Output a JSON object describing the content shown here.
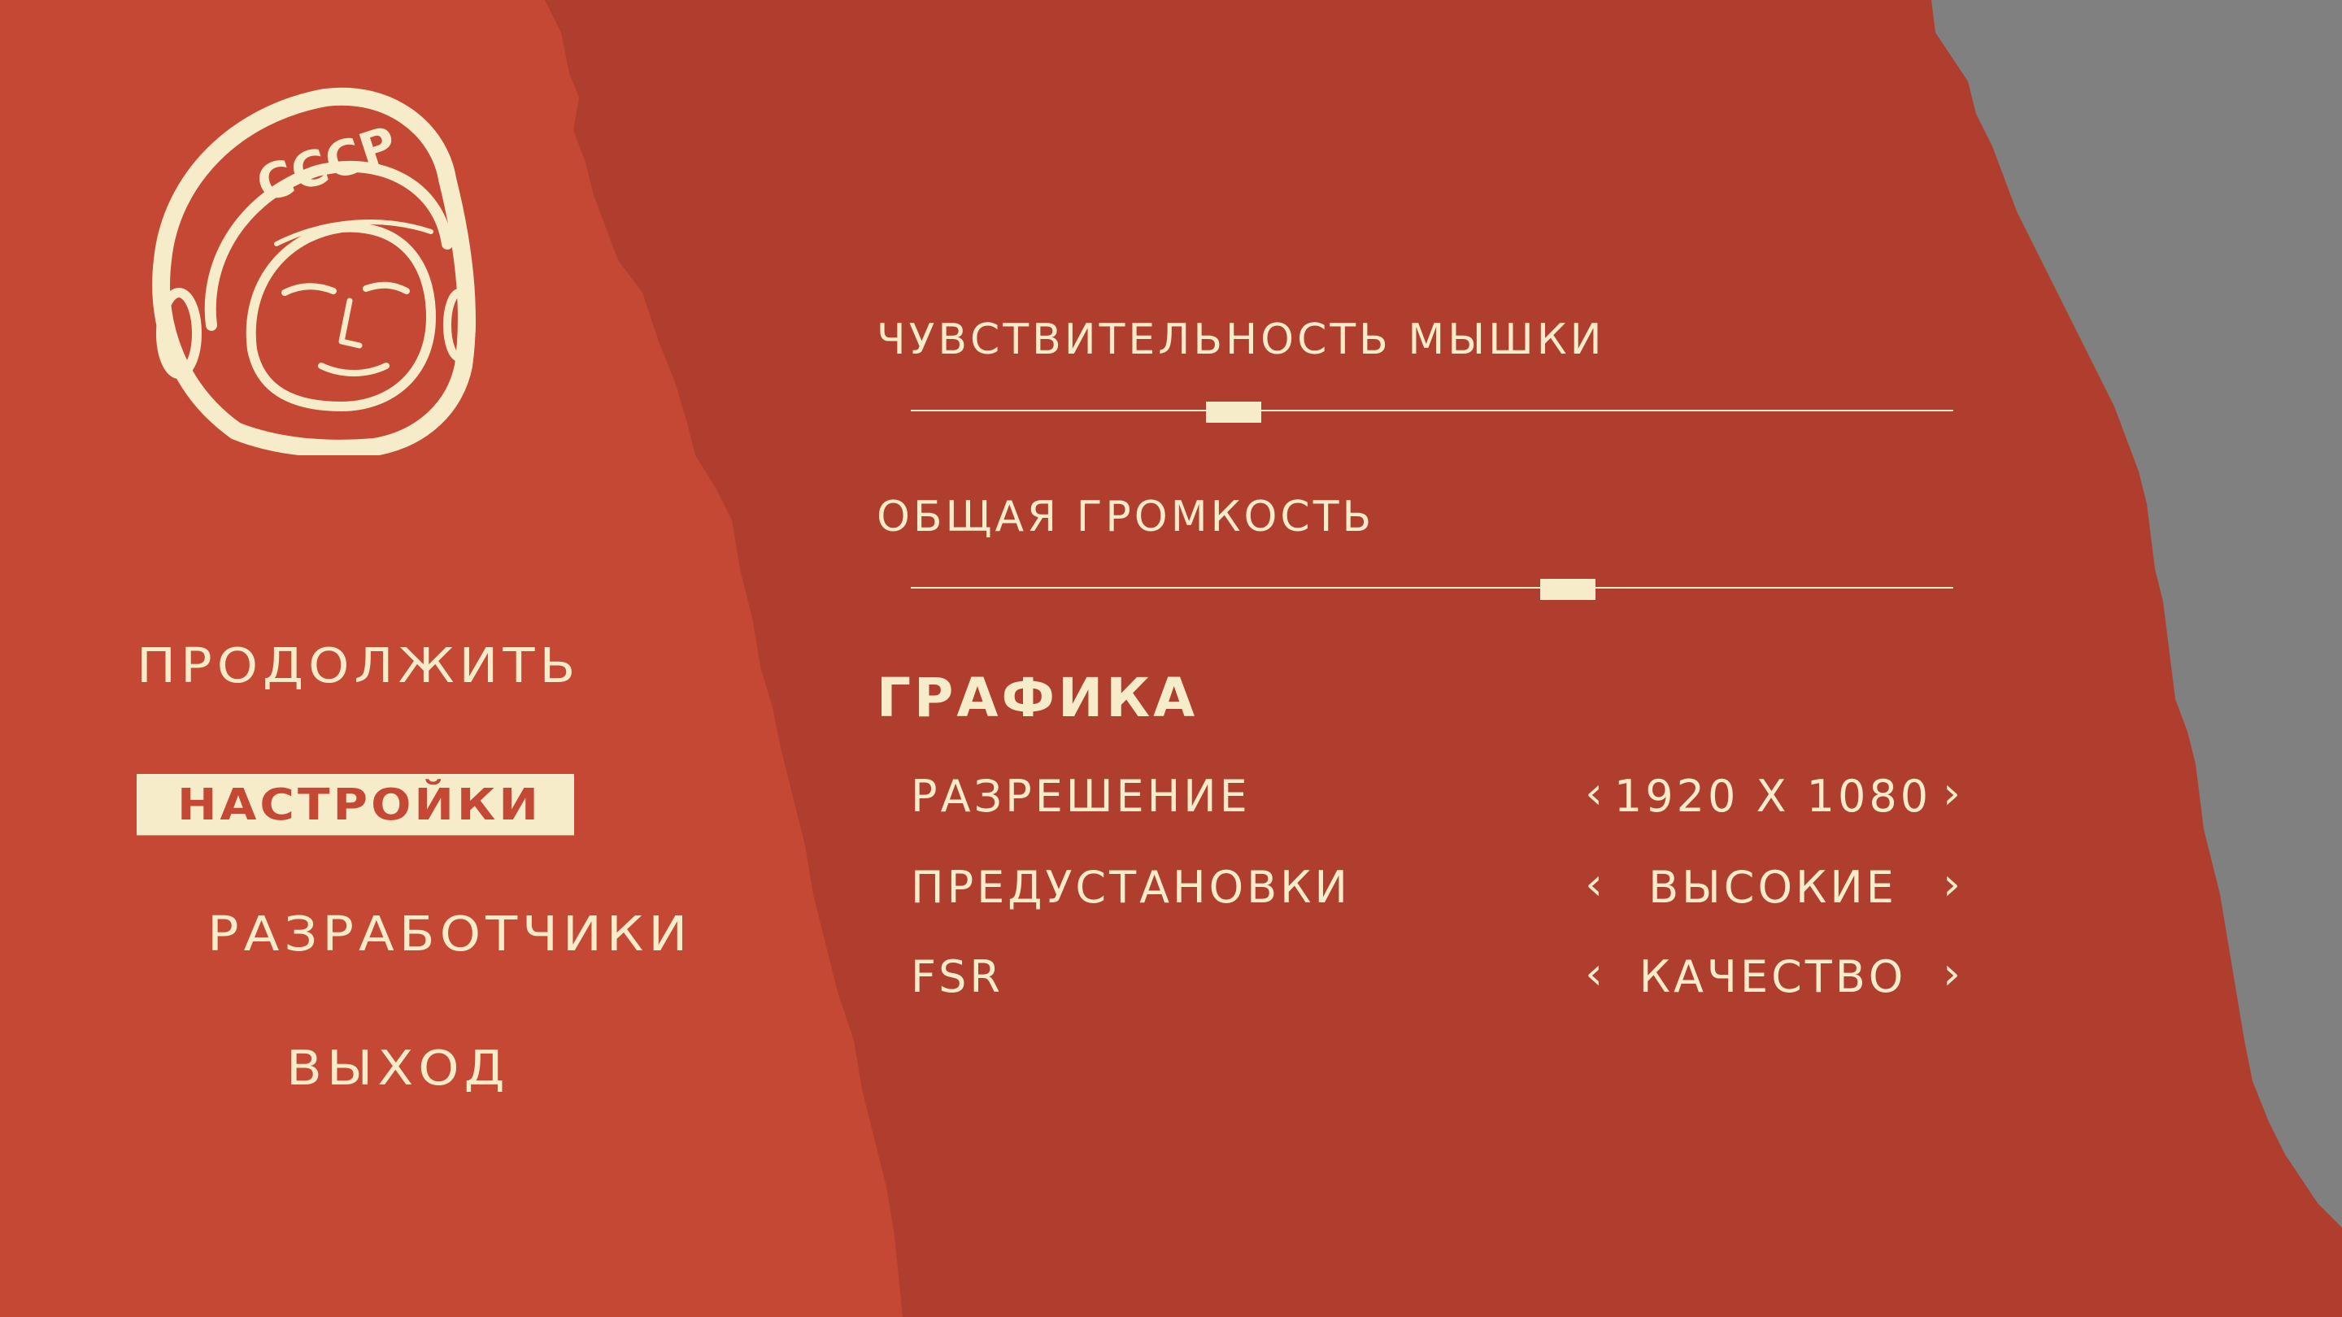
{
  "colors": {
    "background_left": "#c44834",
    "background_center": "#b03e2e",
    "background_right": "#808080",
    "foreground": "#f6ecc9"
  },
  "logo": {
    "text": "СССР",
    "icon": "cosmonaut-helmet-icon"
  },
  "menu": {
    "items": [
      {
        "label": "ПРОДОЛЖИТЬ",
        "selected": false
      },
      {
        "label": "НАСТРОЙКИ",
        "selected": true
      },
      {
        "label": "РАЗРАБОТЧИКИ",
        "selected": false
      },
      {
        "label": "ВЫХОД",
        "selected": false
      }
    ]
  },
  "settings": {
    "mouse_sensitivity": {
      "label": "ЧУВСТВИТЕЛЬНОСТЬ МЫШКИ",
      "value_fraction": 0.31
    },
    "master_volume": {
      "label": "ОБЩАЯ ГРОМКОСТЬ",
      "value_fraction": 0.63
    },
    "graphics": {
      "header": "ГРАФИКА",
      "resolution": {
        "label": "РАЗРЕШЕНИЕ",
        "value": "1920 X 1080"
      },
      "preset": {
        "label": "ПРЕДУСТАНОВКИ",
        "value": "ВЫСОКИЕ"
      },
      "fsr": {
        "label": "FSR",
        "value": "КАЧЕСТВО"
      },
      "prev_arrow": "‹",
      "next_arrow": "›"
    }
  }
}
